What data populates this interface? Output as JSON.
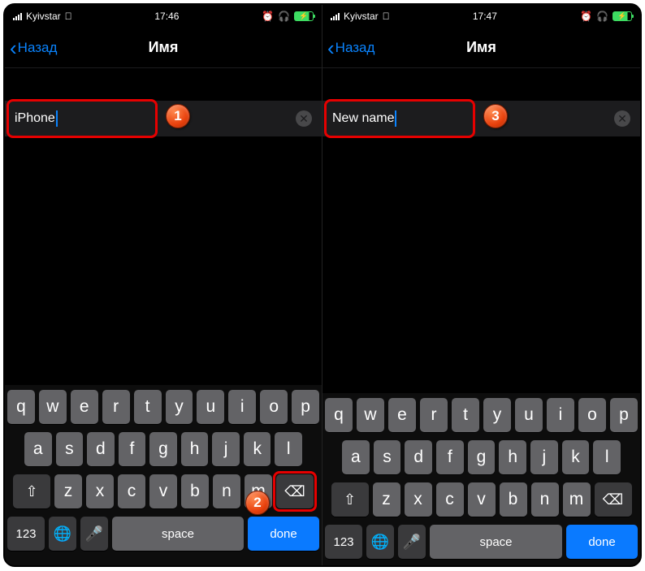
{
  "left": {
    "status": {
      "carrier": "Kyivstar",
      "time": "17:46"
    },
    "nav": {
      "back": "Назад",
      "title": "Имя"
    },
    "input": {
      "value": "iPhone"
    },
    "badges": {
      "one": "1",
      "two": "2"
    }
  },
  "right": {
    "status": {
      "carrier": "Kyivstar",
      "time": "17:47"
    },
    "nav": {
      "back": "Назад",
      "title": "Имя"
    },
    "input": {
      "value": "New name"
    },
    "badges": {
      "three": "3"
    }
  },
  "keyboard": {
    "row1": [
      "q",
      "w",
      "e",
      "r",
      "t",
      "y",
      "u",
      "i",
      "o",
      "p"
    ],
    "row2": [
      "a",
      "s",
      "d",
      "f",
      "g",
      "h",
      "j",
      "k",
      "l"
    ],
    "row3": [
      "z",
      "x",
      "c",
      "v",
      "b",
      "n",
      "m"
    ],
    "shift": "⇧",
    "backspace": "⌫",
    "num": "123",
    "emoji": "🌐",
    "mic": "🎤",
    "space": "space",
    "done": "done"
  }
}
